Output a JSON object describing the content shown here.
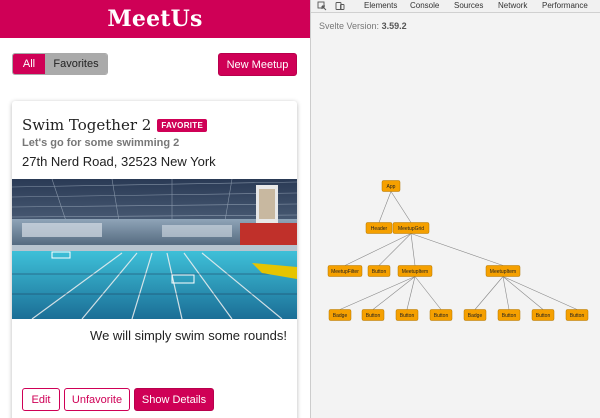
{
  "app": {
    "title": "MeetUs",
    "filters": [
      "All",
      "Favorites"
    ],
    "new_meetup_label": "New Meetup",
    "colors": {
      "accent": "#cf0056",
      "inactive": "#aaaaaa"
    }
  },
  "meetup": {
    "title": "Swim Together 2",
    "badge": "FAVORITE",
    "subtitle": "Let's go for some swimming 2",
    "address": "27th Nerd Road, 32523 New York",
    "image": "indoor-swimming-pool-photo",
    "description": "We will simply swim some rounds!",
    "actions": {
      "edit": "Edit",
      "unfavorite": "Unfavorite",
      "details": "Show Details"
    }
  },
  "devtools": {
    "toolbar_icons": [
      "inspect-element-icon",
      "device-toolbar-icon"
    ],
    "tabs": [
      "Elements",
      "Console",
      "Sources",
      "Network",
      "Performance"
    ],
    "version_label": "Svelte Version:",
    "version_value": "3.59.2",
    "node_color": "#f5a000",
    "tree": {
      "app": "App",
      "header": "Header",
      "grid": "MeetupGrid",
      "filter": "MeetupFilter",
      "button": "Button",
      "item": "MeetupItem",
      "badge": "Badge"
    }
  }
}
